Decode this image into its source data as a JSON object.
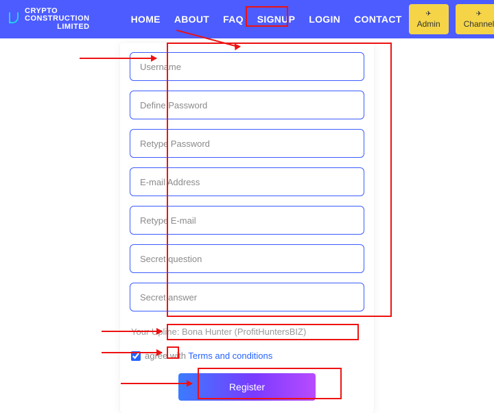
{
  "brand": {
    "line1": "CRYPTO CONSTRUCTION",
    "line2": "LIMITED"
  },
  "nav": {
    "home": "HOME",
    "about": "ABOUT",
    "faq": "FAQ",
    "signup": "SIGNUP",
    "login": "LOGIN",
    "contact": "CONTACT"
  },
  "header_buttons": {
    "admin": "Admin",
    "channel": "Channel"
  },
  "form": {
    "username_ph": "Username",
    "password_ph": "Define Password",
    "password2_ph": "Retype Password",
    "email_ph": "E-mail Address",
    "email2_ph": "Retype E-mail",
    "question_ph": "Secret question",
    "answer_ph": "Secret answer"
  },
  "upline_text": "Your Upline: Bona Hunter (ProfitHuntersBIZ)",
  "agree": {
    "prefix": "agree with ",
    "link": "Terms and conditions",
    "checked": true
  },
  "register_label": "Register"
}
